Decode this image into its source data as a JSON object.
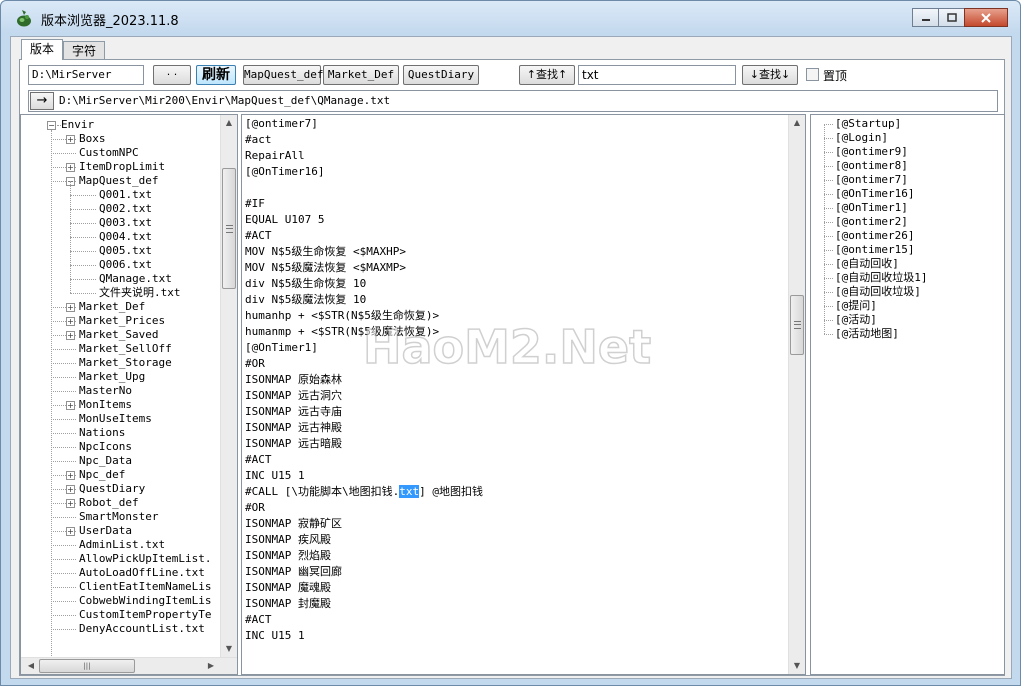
{
  "window": {
    "title": "版本浏览器_2023.11.8"
  },
  "tabs": [
    "版本",
    "字符"
  ],
  "toolbar": {
    "root_path": "D:\\MirServer",
    "browse_label": "· ·",
    "refresh_label": "刷新",
    "shortcut_buttons": [
      "MapQuest_def",
      "Market_Def",
      "QuestDiary"
    ],
    "find_up_label": "↑查找↑",
    "search_value": "txt",
    "find_down_label": "↓查找↓",
    "pin_label": "置顶",
    "pin_checked": false
  },
  "pathbar": {
    "go_label": "→",
    "current_file": "D:\\MirServer\\Mir200\\Envir\\MapQuest_def\\QManage.txt"
  },
  "tree": {
    "root": "Envir",
    "items": [
      {
        "label": "Boxs",
        "level": 1,
        "expandable": true
      },
      {
        "label": "CustomNPC",
        "level": 1,
        "expandable": false
      },
      {
        "label": "ItemDropLimit",
        "level": 1,
        "expandable": true
      },
      {
        "label": "MapQuest_def",
        "level": 1,
        "expandable": true,
        "expanded": true
      },
      {
        "label": "Q001.txt",
        "level": 2,
        "expandable": false
      },
      {
        "label": "Q002.txt",
        "level": 2,
        "expandable": false
      },
      {
        "label": "Q003.txt",
        "level": 2,
        "expandable": false
      },
      {
        "label": "Q004.txt",
        "level": 2,
        "expandable": false
      },
      {
        "label": "Q005.txt",
        "level": 2,
        "expandable": false
      },
      {
        "label": "Q006.txt",
        "level": 2,
        "expandable": false
      },
      {
        "label": "QManage.txt",
        "level": 2,
        "expandable": false
      },
      {
        "label": "文件夹说明.txt",
        "level": 2,
        "expandable": false
      },
      {
        "label": "Market_Def",
        "level": 1,
        "expandable": true
      },
      {
        "label": "Market_Prices",
        "level": 1,
        "expandable": true
      },
      {
        "label": "Market_Saved",
        "level": 1,
        "expandable": true
      },
      {
        "label": "Market_SellOff",
        "level": 1,
        "expandable": false
      },
      {
        "label": "Market_Storage",
        "level": 1,
        "expandable": false
      },
      {
        "label": "Market_Upg",
        "level": 1,
        "expandable": false
      },
      {
        "label": "MasterNo",
        "level": 1,
        "expandable": false
      },
      {
        "label": "MonItems",
        "level": 1,
        "expandable": true
      },
      {
        "label": "MonUseItems",
        "level": 1,
        "expandable": false
      },
      {
        "label": "Nations",
        "level": 1,
        "expandable": false
      },
      {
        "label": "NpcIcons",
        "level": 1,
        "expandable": false
      },
      {
        "label": "Npc_Data",
        "level": 1,
        "expandable": false
      },
      {
        "label": "Npc_def",
        "level": 1,
        "expandable": true
      },
      {
        "label": "QuestDiary",
        "level": 1,
        "expandable": true
      },
      {
        "label": "Robot_def",
        "level": 1,
        "expandable": true
      },
      {
        "label": "SmartMonster",
        "level": 1,
        "expandable": false
      },
      {
        "label": "UserData",
        "level": 1,
        "expandable": true
      },
      {
        "label": "AdminList.txt",
        "level": 1,
        "expandable": false
      },
      {
        "label": "AllowPickUpItemList.",
        "level": 1,
        "expandable": false
      },
      {
        "label": "AutoLoadOffLine.txt",
        "level": 1,
        "expandable": false
      },
      {
        "label": "ClientEatItemNameLis",
        "level": 1,
        "expandable": false
      },
      {
        "label": "CobwebWindingItemLis",
        "level": 1,
        "expandable": false
      },
      {
        "label": "CustomItemPropertyTe",
        "level": 1,
        "expandable": false
      },
      {
        "label": "DenyAccountList.txt",
        "level": 1,
        "expandable": false
      }
    ]
  },
  "editor": {
    "lines": [
      "[@ontimer7]",
      "#act",
      "RepairAll",
      "[@OnTimer16]",
      "",
      "#IF",
      "EQUAL U107 5",
      "#ACT",
      "MOV N$5级生命恢复 <$MAXHP>",
      "MOV N$5级魔法恢复 <$MAXMP>",
      "div N$5级生命恢复 10",
      "div N$5级魔法恢复 10",
      "humanhp + <$STR(N$5级生命恢复)>",
      "humanmp + <$STR(N$5级魔法恢复)>",
      "[@OnTimer1]",
      "#OR",
      "ISONMAP 原始森林",
      "ISONMAP 远古洞穴",
      "ISONMAP 远古寺庙",
      "ISONMAP 远古神殿",
      "ISONMAP 远古暗殿",
      "#ACT",
      "INC U15 1",
      "#CALL [\\功能脚本\\地图扣钱.txt] @地图扣钱",
      "#OR",
      "ISONMAP 寂静矿区",
      "ISONMAP 疾风殿",
      "ISONMAP 烈焰殿",
      "ISONMAP 幽冥回廊",
      "ISONMAP 魔魂殿",
      "ISONMAP 封魔殿",
      "#ACT",
      "INC U15 1"
    ],
    "call_prefix": "#CALL [\\功能脚本\\地图扣钱.",
    "call_match": "txt",
    "call_suffix": "] @地图扣钱"
  },
  "outline": {
    "labels": [
      "[@Startup]",
      "[@Login]",
      "[@ontimer9]",
      "[@ontimer8]",
      "[@ontimer7]",
      "[@OnTimer16]",
      "[@OnTimer1]",
      "[@ontimer2]",
      "[@ontimer26]",
      "[@ontimer15]",
      "[@自动回收]",
      "[@自动回收垃圾1]",
      "[@自动回收垃圾]",
      "[@提问]",
      "[@活动]",
      "[@活动地图]"
    ]
  },
  "watermark": {
    "text": "HaoM2.Net"
  },
  "colors": {
    "selection": "#3399ff",
    "titlebar": "#c4d9ee",
    "close_button": "#c4492c"
  }
}
